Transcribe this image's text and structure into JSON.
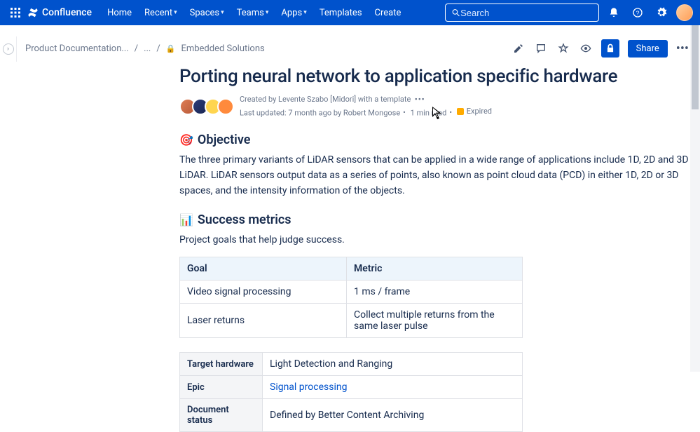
{
  "nav": {
    "product": "Confluence",
    "items": [
      "Home",
      "Recent",
      "Spaces",
      "Teams",
      "Apps",
      "Templates",
      "Create"
    ],
    "dropdownFlags": [
      false,
      true,
      true,
      true,
      true,
      false,
      false
    ],
    "searchPlaceholder": "Search"
  },
  "breadcrumbs": {
    "root": "Product Documentation...",
    "mid": "...",
    "leaf": "Embedded Solutions"
  },
  "actions": {
    "share": "Share"
  },
  "page": {
    "title": "Porting neural network to application specific hardware",
    "createdBy": "Created by Levente Szabo [Midori] with a template",
    "lastUpdated": "Last updated: 7 month ago by Robert Mongose",
    "readTime": "1 min read",
    "expiredLabel": "Expired"
  },
  "sections": {
    "objective": {
      "emoji": "🎯",
      "heading": "Objective",
      "body": "The three primary variants of LiDAR sensors that can be applied in a wide range of applications include 1D, 2D and 3D LiDAR. LiDAR sensors output data as a series of points, also known as point cloud data (PCD) in either 1D, 2D or 3D spaces, and the intensity information of the objects."
    },
    "metrics": {
      "emoji": "📊",
      "heading": "Success metrics",
      "intro": "Project goals that help judge success.",
      "headers": {
        "goal": "Goal",
        "metric": "Metric"
      },
      "rows": [
        {
          "goal": "Video signal processing",
          "metric": "1 ms / frame"
        },
        {
          "goal": "Laser returns",
          "metric": "Collect multiple returns from the same laser pulse"
        }
      ]
    },
    "summary": {
      "rows": [
        {
          "label": "Target hardware",
          "value": "Light Detection and Ranging",
          "link": false
        },
        {
          "label": "Epic",
          "value": "Signal processing",
          "link": true
        },
        {
          "label": "Document status",
          "value": "Defined by Better Content Archiving",
          "link": false
        }
      ]
    }
  }
}
